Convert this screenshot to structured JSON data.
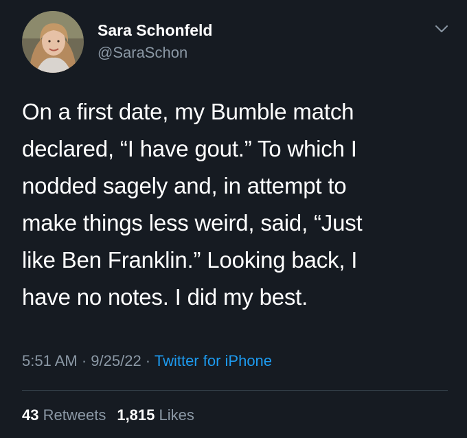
{
  "author": {
    "name": "Sara Schonfeld",
    "handle": "@SaraSchon"
  },
  "tweet": {
    "lines": [
      "On a first date, my Bumble match",
      "declared, “I have gout.” To which I",
      "nodded sagely and, in attempt to",
      "make things less weird, said, “Just",
      "like Ben Franklin.” Looking back, I",
      "have no notes. I did my best."
    ]
  },
  "meta": {
    "time": "5:51 AM",
    "separator": " · ",
    "date": "9/25/22",
    "source": "Twitter for iPhone"
  },
  "stats": {
    "retweets_count": "43",
    "retweets_label": "Retweets",
    "likes_count": "1,815",
    "likes_label": "Likes"
  },
  "icons": {
    "menu": "chevron-down-icon"
  },
  "colors": {
    "background": "#161b22",
    "text": "#ffffff",
    "secondary": "#8b98a5",
    "link": "#1d9bf0",
    "divider": "#38444d"
  }
}
